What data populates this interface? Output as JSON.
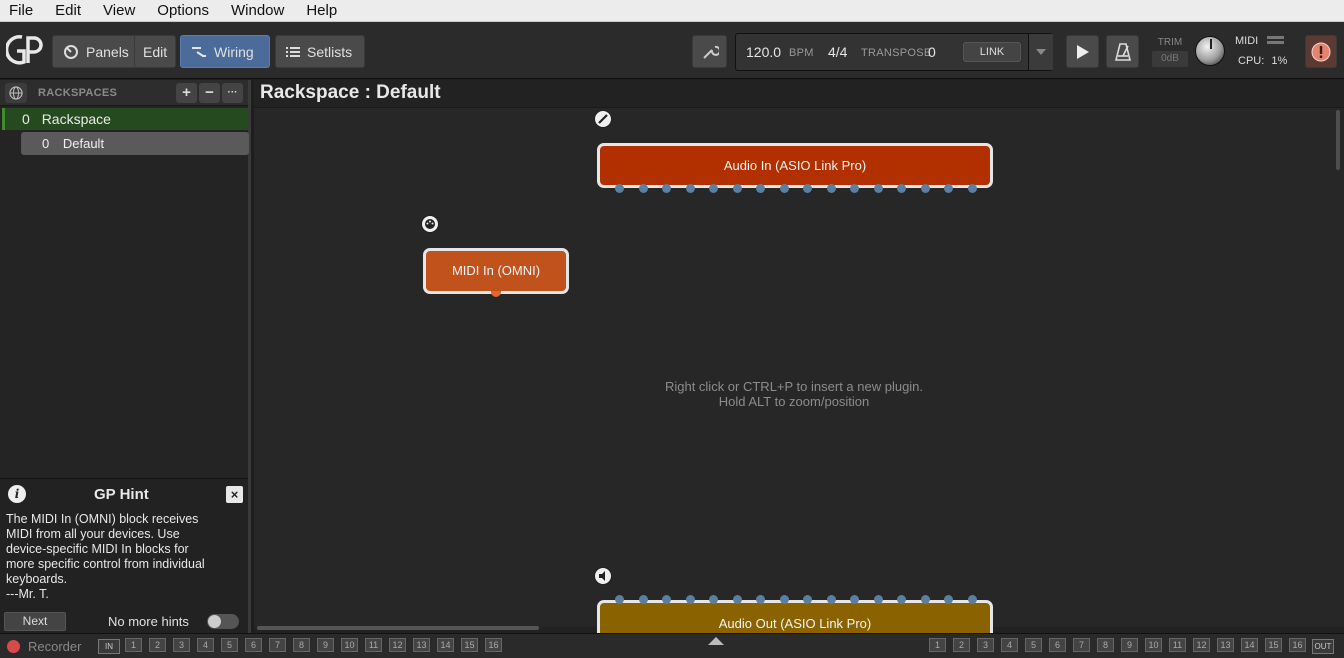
{
  "menubar": {
    "items": [
      "File",
      "Edit",
      "View",
      "Options",
      "Window",
      "Help"
    ]
  },
  "toolbar": {
    "panels_label": "Panels",
    "edit_label": "Edit",
    "wiring_label": "Wiring",
    "setlists_label": "Setlists",
    "bpm_value": "120.0",
    "bpm_label": "BPM",
    "time_signature": "4/4",
    "transpose_label": "TRANSPOSE",
    "transpose_value": "0",
    "link_label": "LINK",
    "trim_label": "TRIM",
    "trim_value": "0dB",
    "midi_label": "MIDI",
    "cpu_label": "CPU:",
    "cpu_value": "1%"
  },
  "sidebar": {
    "header": "RACKSPACES",
    "add": "+",
    "remove": "−",
    "more": "···",
    "rackspaces": [
      {
        "index": "0",
        "name": "Rackspace",
        "variations": [
          {
            "index": "0",
            "name": "Default"
          }
        ]
      }
    ]
  },
  "hint": {
    "title": "GP Hint",
    "close": "×",
    "text_lines": [
      "The MIDI In (OMNI) block receives",
      "MIDI from all your devices. Use",
      "device-specific MIDI In blocks for",
      "more specific control from individual",
      "keyboards.",
      "---Mr. T."
    ],
    "next_label": "Next",
    "no_more_hints_label": "No more hints"
  },
  "canvas": {
    "title": "Rackspace : Default",
    "hint_line1": "Right click or CTRL+P to insert a new plugin.",
    "hint_line2": "Hold ALT to zoom/position",
    "blocks": {
      "audio_in": "Audio In (ASIO Link Pro)",
      "midi_in": "MIDI In (OMNI)",
      "audio_out": "Audio Out (ASIO Link Pro)"
    },
    "colors": {
      "audio_in": "#b23000",
      "midi_in": "#c2521c",
      "audio_out": "#8a6300"
    }
  },
  "bottom": {
    "recorder_label": "Recorder",
    "in_label": "IN",
    "out_label": "OUT",
    "channels": [
      "1",
      "2",
      "3",
      "4",
      "5",
      "6",
      "7",
      "8",
      "9",
      "10",
      "11",
      "12",
      "13",
      "14",
      "15",
      "16"
    ]
  }
}
